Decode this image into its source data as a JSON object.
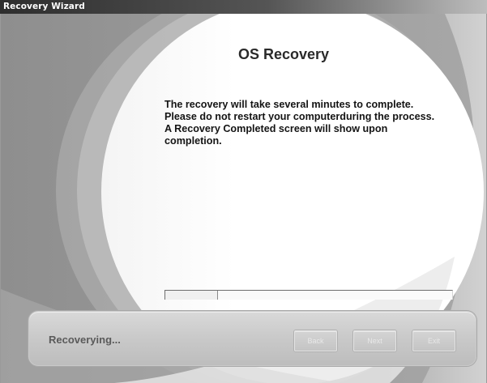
{
  "window": {
    "title": "Recovery Wizard"
  },
  "main": {
    "heading": "OS Recovery",
    "message_lines": [
      "The recovery will take several minutes to complete.",
      "Please do not restart your computerduring the process.",
      "A Recovery Completed screen will show upon",
      "completion."
    ],
    "progress_fraction": 0.18
  },
  "footer": {
    "status": "Recoverying...",
    "buttons": {
      "back": "Back",
      "next": "Next",
      "exit": "Exit"
    }
  }
}
